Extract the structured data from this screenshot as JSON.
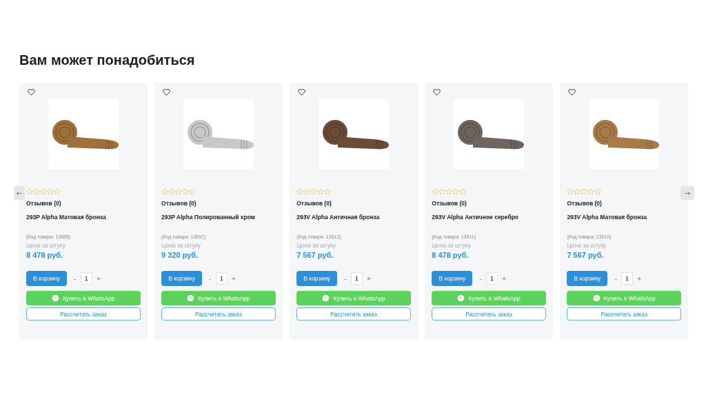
{
  "section": {
    "title": "Вам может понадобиться"
  },
  "nav": {
    "prev": "←",
    "next": "→"
  },
  "products": [
    {
      "name": "293P Alpha Матовая бронза",
      "color": "#a0703a",
      "stars": 0,
      "reviews": "Отзывов (0)",
      "code": "(Код товара: 13655)",
      "price_label": "Цена за штуку",
      "price": "8 478 руб.",
      "cart": "В корзину",
      "minus": "-",
      "qty": "1",
      "plus": "+",
      "whatsapp": "Купить в WhatsApp",
      "calc": "Рассчитать заказ"
    },
    {
      "name": "293P Alpha Полированный хром",
      "color": "#c8c8c8",
      "stars": 0,
      "reviews": "Отзывов (0)",
      "code": "(Код товара: 13657)",
      "price_label": "Цена за штуку",
      "price": "9 320 руб.",
      "cart": "В корзину",
      "minus": "-",
      "qty": "1",
      "plus": "+",
      "whatsapp": "Купить в WhatsApp",
      "calc": "Рассчитать заказ"
    },
    {
      "name": "293V Alpha Античная бронза",
      "color": "#6b4a38",
      "stars": 0,
      "reviews": "Отзывов (0)",
      "code": "(Код товара: 13612)",
      "price_label": "Цена за штуку",
      "price": "7 567 руб.",
      "cart": "В корзину",
      "minus": "-",
      "qty": "1",
      "plus": "+",
      "whatsapp": "Купить в WhatsApp",
      "calc": "Рассчитать заказ"
    },
    {
      "name": "293V Alpha Античное серебро",
      "color": "#6e6460",
      "stars": 0,
      "reviews": "Отзывов (0)",
      "code": "(Код товара: 13611)",
      "price_label": "Цена за штуку",
      "price": "8 478 руб.",
      "cart": "В корзину",
      "minus": "-",
      "qty": "1",
      "plus": "+",
      "whatsapp": "Купить в WhatsApp",
      "calc": "Рассчитать заказ"
    },
    {
      "name": "293V Alpha Матовая бронза",
      "color": "#a87a48",
      "stars": 0,
      "reviews": "Отзывов (0)",
      "code": "(Код товара: 13610)",
      "price_label": "Цена за штуку",
      "price": "7 567 руб.",
      "cart": "В корзину",
      "minus": "-",
      "qty": "1",
      "plus": "+",
      "whatsapp": "Купить в WhatsApp",
      "calc": "Рассчитать заказ"
    }
  ]
}
